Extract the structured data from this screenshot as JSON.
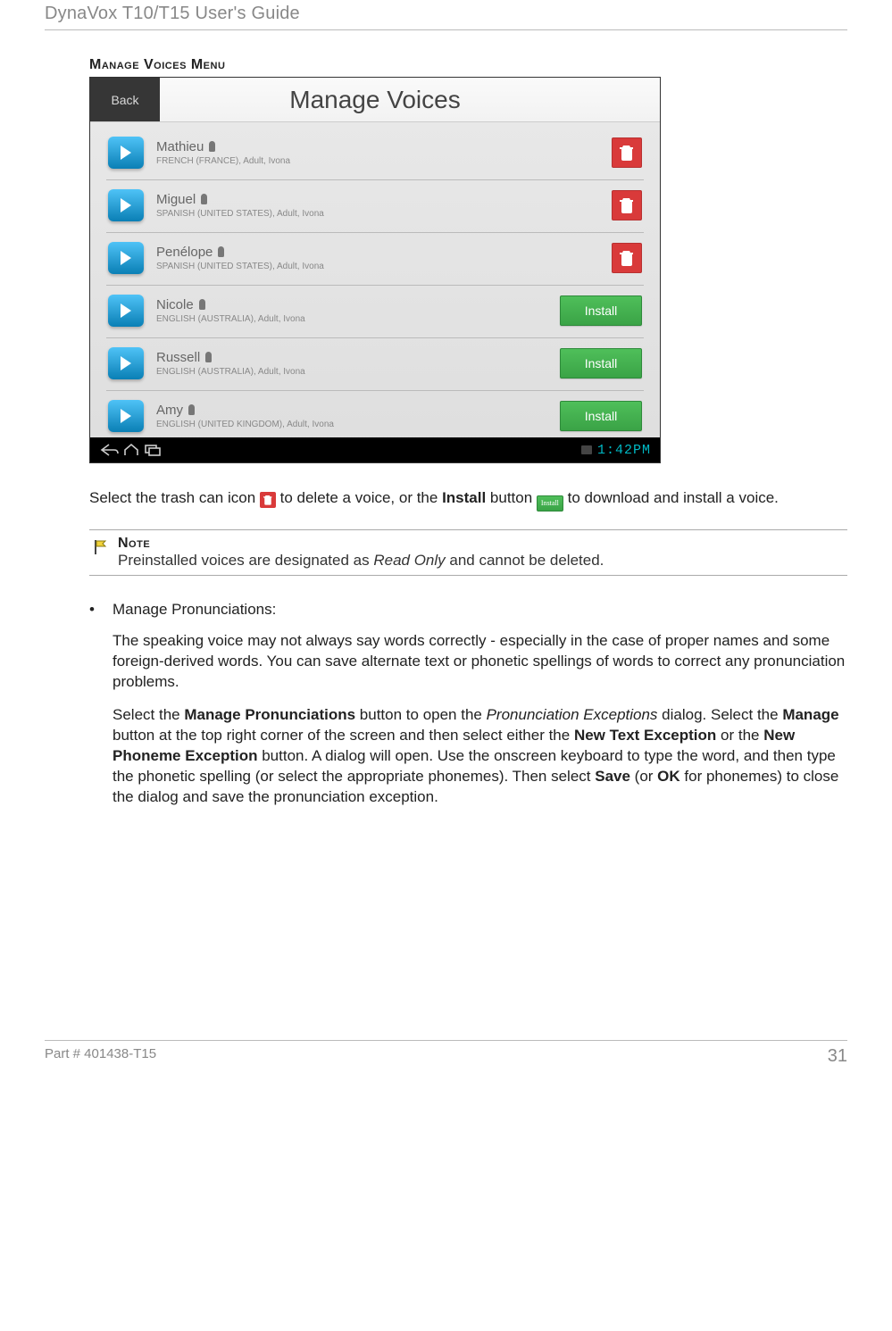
{
  "header": {
    "title": "DynaVox T10/T15 User's Guide"
  },
  "figure": {
    "caption": "Manage Voices Menu",
    "screen": {
      "back_label": "Back",
      "title": "Manage Voices",
      "clock": "1:42PM",
      "install_label": "Install",
      "voices": [
        {
          "name": "Mathieu",
          "meta": "FRENCH (FRANCE), Adult, Ivona",
          "action": "delete"
        },
        {
          "name": "Miguel",
          "meta": "SPANISH (UNITED STATES), Adult, Ivona",
          "action": "delete"
        },
        {
          "name": "Penélope",
          "meta": "SPANISH (UNITED STATES), Adult, Ivona",
          "action": "delete"
        },
        {
          "name": "Nicole",
          "meta": "ENGLISH (AUSTRALIA), Adult, Ivona",
          "action": "install"
        },
        {
          "name": "Russell",
          "meta": "ENGLISH (AUSTRALIA), Adult, Ivona",
          "action": "install"
        },
        {
          "name": "Amy",
          "meta": "ENGLISH (UNITED KINGDOM), Adult, Ivona",
          "action": "install"
        }
      ]
    }
  },
  "body": {
    "p1a": "Select the trash can icon ",
    "p1b": " to delete a voice, or the ",
    "p1_bold1": "Install",
    "p1c": " button ",
    "p1d": " to download and install a voice.",
    "note_title": "Note",
    "note_text_a": "Preinstalled voices are designated as ",
    "note_em": "Read Only",
    "note_text_b": " and cannot be deleted.",
    "bullet_label": "Manage Pronunciations:",
    "p2": "The speaking voice may not always say words correctly - especially in the case of proper names and some foreign-derived words. You can save alternate text or phonetic spellings of words to correct any pronunciation problems.",
    "p3a": "Select the ",
    "p3_b1": "Manage Pronunciations",
    "p3b": " button to open the ",
    "p3_i1": "Pronunciation Exceptions",
    "p3c": " dialog. Select the ",
    "p3_b2": "Manage",
    "p3d": " button at the top right corner of the screen and then select either the ",
    "p3_b3": "New Text Exception",
    "p3e": " or the ",
    "p3_b4": "New Phoneme Exception",
    "p3f": " button. A dialog will open. Use the onscreen keyboard to type the word, and then type the phonetic spelling (or select the appropriate phonemes). Then select ",
    "p3_b5": "Save",
    "p3g": " (or ",
    "p3_b6": "OK",
    "p3h": " for phonemes) to close the dialog and save the pronunciation exception."
  },
  "footer": {
    "part": "Part # 401438-T15",
    "page": "31"
  }
}
